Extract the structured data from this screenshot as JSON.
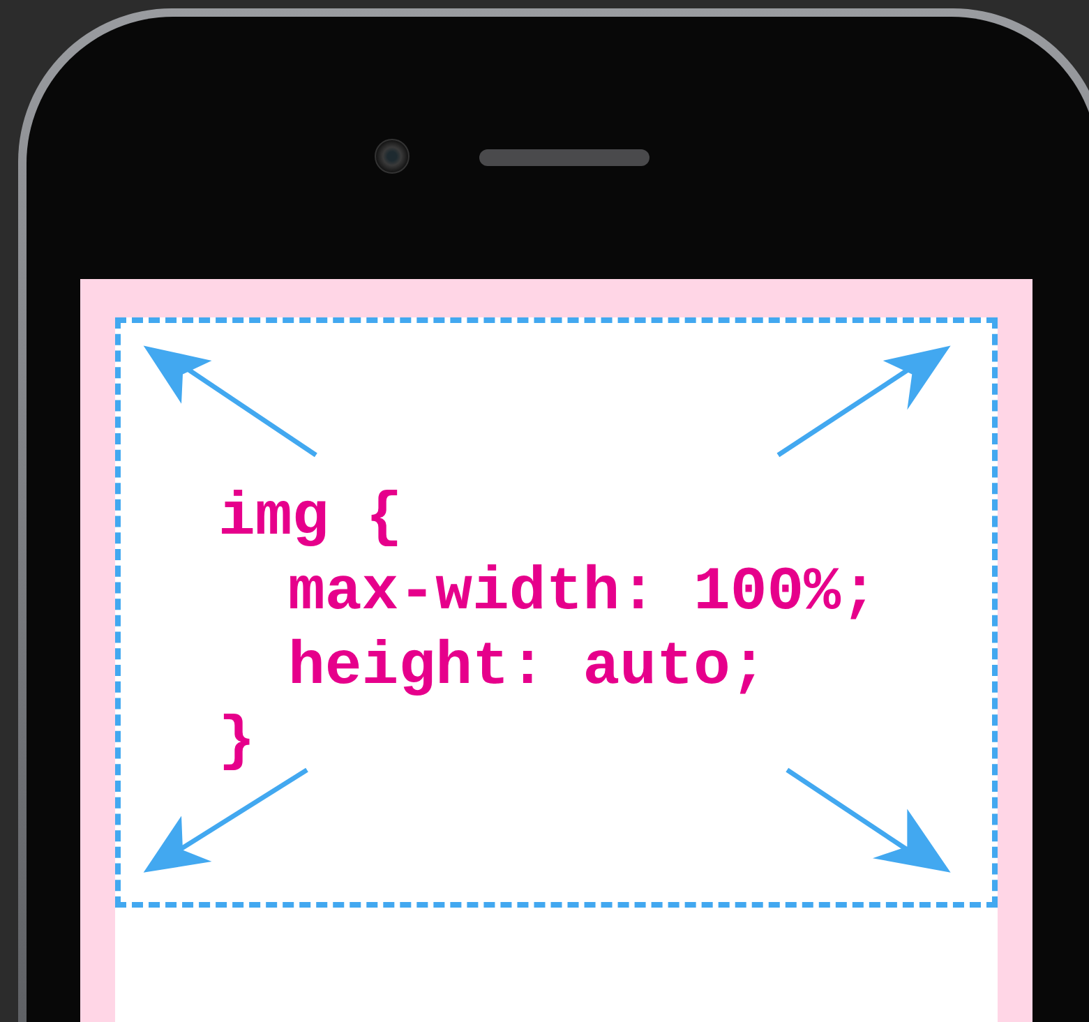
{
  "code": {
    "opening": "img {",
    "declarations": [
      "max-width: 100%;",
      "height: auto;"
    ],
    "closing": "}"
  }
}
